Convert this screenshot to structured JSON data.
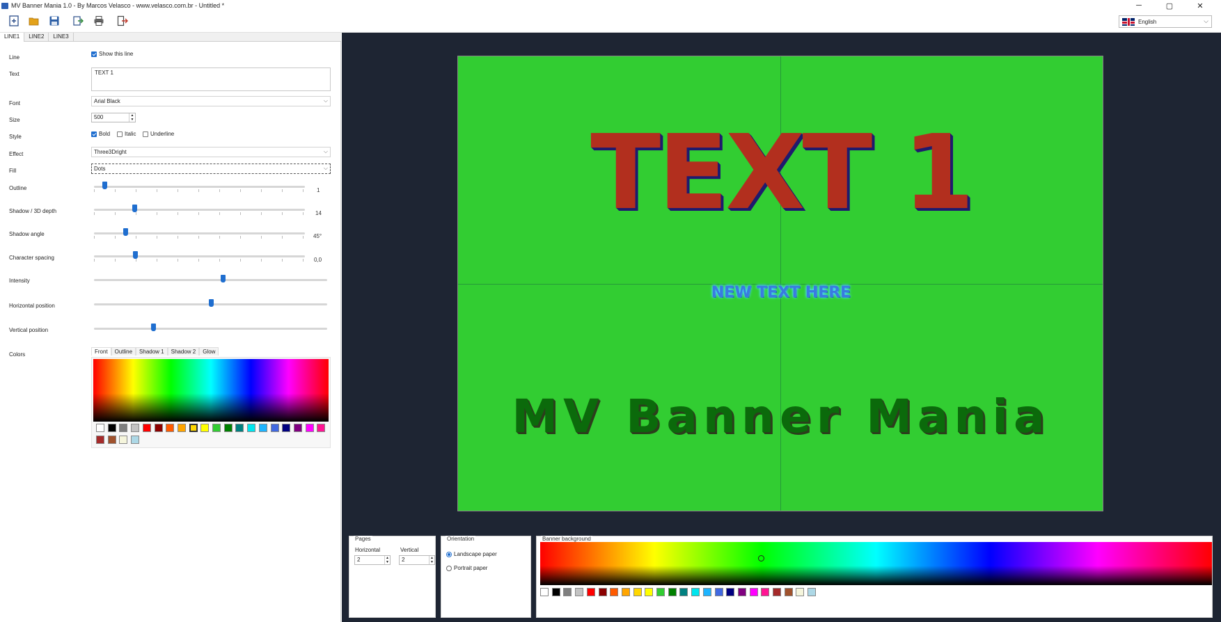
{
  "window": {
    "title": "MV Banner Mania 1.0 - By Marcos Velasco - www.velasco.com.br - Untitled *",
    "minimize": "─",
    "maximize": "▢",
    "close": "✕"
  },
  "toolbar": {
    "icons": [
      "new-icon",
      "open-icon",
      "save-icon",
      "export-icon",
      "print-icon",
      "exit-icon"
    ],
    "language": "English"
  },
  "line_tabs": [
    "LINE1",
    "LINE2",
    "LINE3"
  ],
  "props": {
    "line_label": "Line",
    "show_line": "Show this line",
    "text_label": "Text",
    "text_value": "TEXT 1",
    "font_label": "Font",
    "font_value": "Arial Black",
    "size_label": "Size",
    "size_value": "500",
    "style_label": "Style",
    "bold": "Bold",
    "italic": "Italic",
    "underline": "Underline",
    "effect_label": "Effect",
    "effect_value": "Three3Dright",
    "fill_label": "Fill",
    "fill_value": "Dots",
    "outline_label": "Outline",
    "outline_value": "1",
    "shadow_label": "Shadow / 3D depth",
    "shadow_value": "14",
    "angle_label": "Shadow angle",
    "angle_value": "45°",
    "spacing_label": "Character spacing",
    "spacing_value": "0,0",
    "intensity_label": "Intensity",
    "hpos_label": "Horizontal position",
    "vpos_label": "Vertical position",
    "colors_label": "Colors"
  },
  "color_tabs": [
    "Front",
    "Outline",
    "Shadow 1",
    "Shadow 2",
    "Glow"
  ],
  "swatches": [
    "#ffffff",
    "#000000",
    "#7f7f7f",
    "#c3c3c3",
    "#ff0000",
    "#8b0000",
    "#ff5a00",
    "#ffa500",
    "#ffd700",
    "#ffff00",
    "#32cd32",
    "#008000",
    "#008080",
    "#00e5ee",
    "#1eb4ff",
    "#4169e1",
    "#000080",
    "#800080",
    "#ff00ff",
    "#ff1493",
    "#a52a2a",
    "#a0522d",
    "#f5f5dc",
    "#add8e6"
  ],
  "banner": {
    "line1": "TEXT 1",
    "line2": "NEW TEXT HERE",
    "line3": "MV Banner Mania",
    "background": "#32cd32"
  },
  "bottom": {
    "pages_title": "Pages",
    "horizontal_label": "Horizontal",
    "horizontal_value": "2",
    "vertical_label": "Vertical",
    "vertical_value": "2",
    "orientation_title": "Orientation",
    "landscape": "Landscape paper",
    "portrait": "Portrait paper",
    "background_title": "Banner background"
  }
}
